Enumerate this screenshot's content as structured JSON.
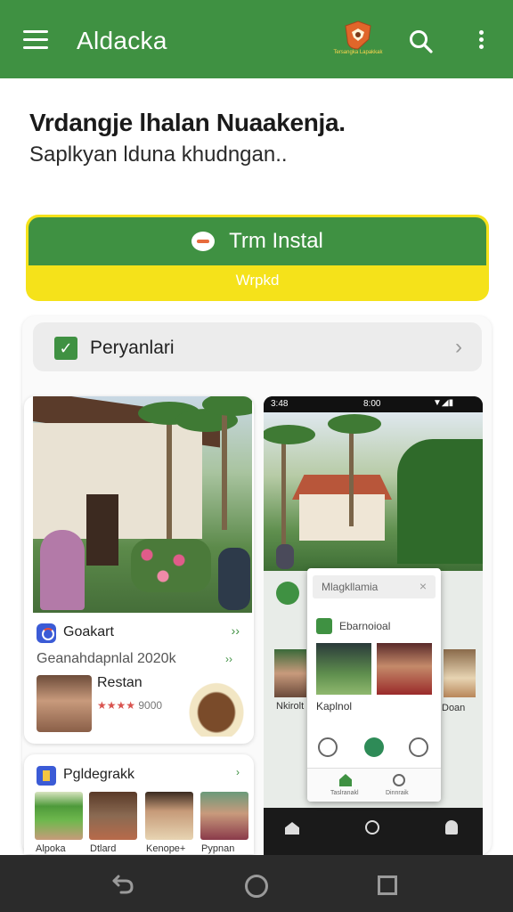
{
  "appbar": {
    "title": "Aldacka",
    "logo_text": "Tersangka Lapakkak",
    "icons": [
      "menu-icon",
      "search-icon",
      "more-vert-icon"
    ]
  },
  "hero": {
    "headline": "Vrdangje lhalan Nuaakenja.",
    "subline": "Saplkyan lduna khudngan.."
  },
  "cta": {
    "label": "Trm Instal",
    "sub_label": "Wrpkd"
  },
  "permission": {
    "label": "Peryanlari"
  },
  "card_left": {
    "header_label": "Goakart",
    "sub_label": "Geanahdapnlal 2020k",
    "item_title": "Restan",
    "stars": "★★★★",
    "price": "9000"
  },
  "card_gallery": {
    "label": "Pgldegrakk",
    "items": [
      "Alpoka",
      "Dtlard",
      "Kenope+",
      "Pypnan"
    ]
  },
  "phone_preview": {
    "status_time": "3:48",
    "status_time_right": "8:00",
    "popup_search": "Mlagkllamia",
    "popup_title": "Ebarnoioal",
    "popup_item": "Kaplnol",
    "nav_home": "Taslranakl",
    "nav_profile": "Dinnraik",
    "side_left": "Nkirolt",
    "side_right": "Doan"
  },
  "colors": {
    "brand_green": "#3f9142",
    "cta_yellow": "#f5e21a",
    "system_nav": "#2b2b2b"
  }
}
